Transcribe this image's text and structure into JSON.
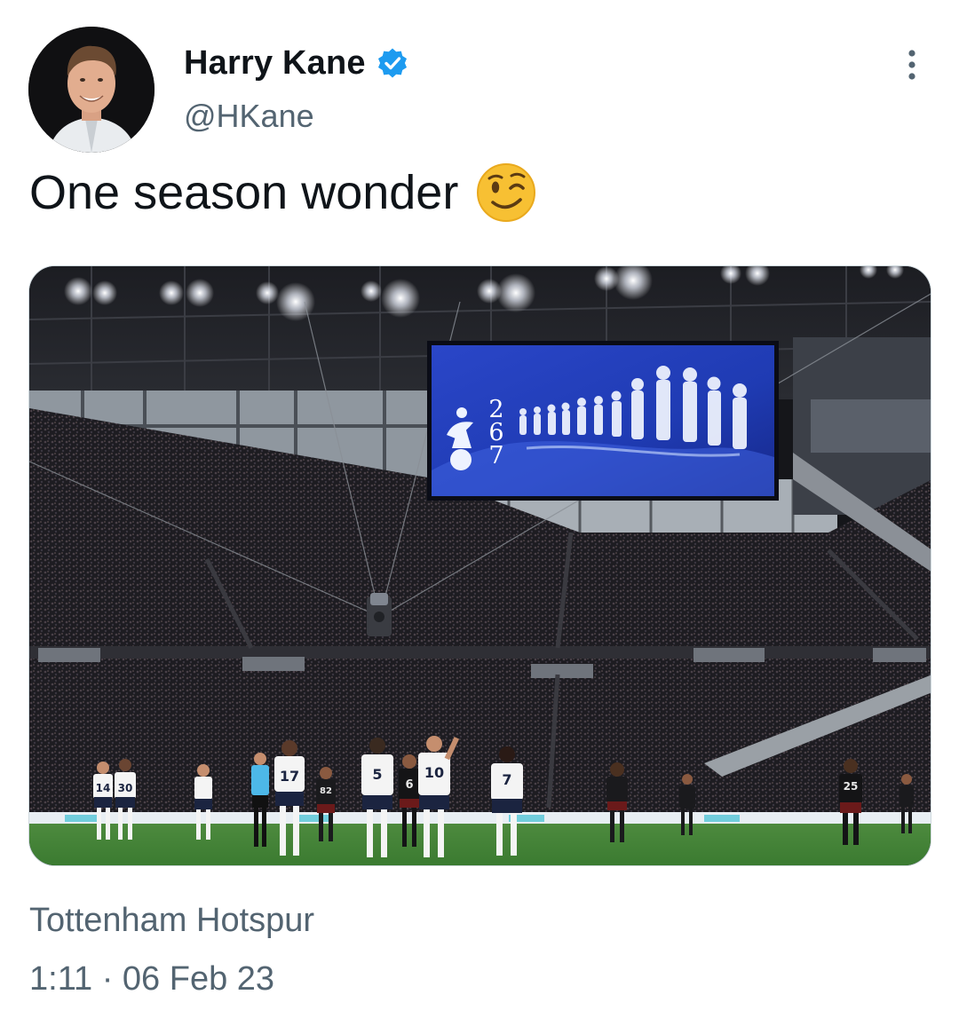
{
  "author": {
    "display_name": "Harry Kane",
    "handle": "@HKane",
    "verified": true,
    "avatar_icon": "avatar-photo"
  },
  "tweet": {
    "text": "One season wonder",
    "emoji": "winking-face",
    "source_label": "Tottenham Hotspur",
    "timestamp": "1:11 · 06 Feb 23"
  },
  "media": {
    "screen_text": [
      "2",
      "6",
      "7"
    ],
    "player_numbers": [
      "14",
      "30",
      "17",
      "82",
      "5",
      "6",
      "10",
      "7",
      "25"
    ]
  },
  "colors": {
    "verified_blue": "#1d9bf0",
    "text_primary": "#0f1419",
    "text_secondary": "#536471",
    "screen_blue": "#1f3bb3"
  }
}
